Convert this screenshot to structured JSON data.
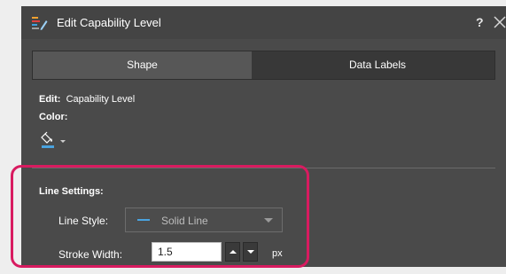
{
  "window": {
    "title": "Edit Capability Level",
    "help_label": "?",
    "title_icon": "chart-edit-icon",
    "close_icon": "close-icon"
  },
  "tabs": [
    {
      "label": "Shape",
      "selected": true
    },
    {
      "label": "Data Labels",
      "selected": false
    }
  ],
  "edit": {
    "prefix": "Edit:",
    "target": "Capability Level"
  },
  "color": {
    "label": "Color:",
    "icon": "paint-bucket-icon",
    "swatch": "#4aa3df"
  },
  "line_settings": {
    "header": "Line Settings:",
    "line_style": {
      "label": "Line Style:",
      "value": "Solid Line",
      "swatch_color": "#4aa3df"
    },
    "stroke_width": {
      "label": "Stroke Width:",
      "value": "1.5",
      "unit": "px"
    }
  },
  "colors": {
    "dialog_bg": "#4a4a4a",
    "highlight": "#d81b60"
  }
}
